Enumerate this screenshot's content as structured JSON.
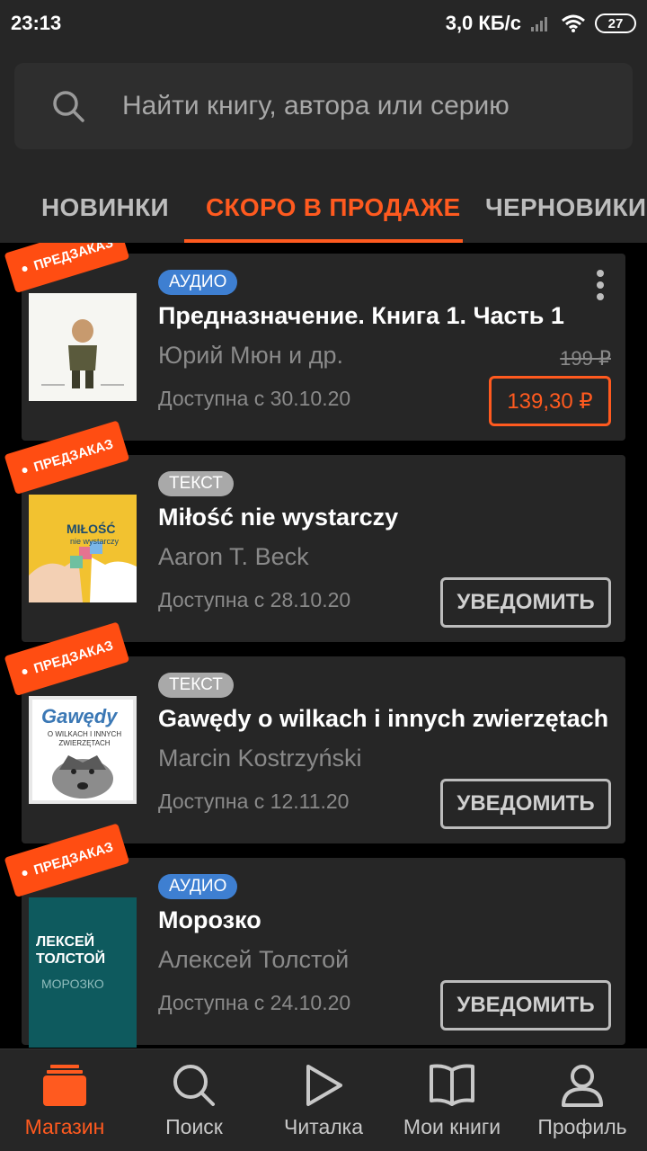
{
  "status_bar": {
    "time": "23:13",
    "speed": "3,0 КБ/с",
    "battery": "27"
  },
  "search": {
    "placeholder": "Найти книгу, автора или серию"
  },
  "tabs": [
    {
      "label": "НОВИНКИ",
      "active": false
    },
    {
      "label": "СКОРО В ПРОДАЖЕ",
      "active": true
    },
    {
      "label": "ЧЕРНОВИКИ",
      "active": false
    }
  ],
  "preorder_label": "ПРЕДЗАКАЗ",
  "books": [
    {
      "type": "АУДИО",
      "title": "Предназначение. Книга 1. Часть 1",
      "author": "Юрий Мюн и др.",
      "available": "Доступна с 30.10.20",
      "old_price": "199 ₽",
      "price": "139,30 ₽"
    },
    {
      "type": "ТЕКСТ",
      "title": "Miłość nie wystarczy",
      "author": "Aaron T. Beck",
      "available": "Доступна с 28.10.20",
      "action": "УВЕДОМИТЬ",
      "cover_text_1": "MIŁOŚĆ",
      "cover_text_2": "nie wystarczy"
    },
    {
      "type": "ТЕКСТ",
      "title": "Gawędy o wilkach i innych zwierzętach",
      "author": "Marcin Kostrzyński",
      "available": "Доступна с 12.11.20",
      "action": "УВЕДОМИТЬ",
      "cover_text_1": "Gawędy",
      "cover_text_2": "O WILKACH I INNYCH ZWIERZĘTACH"
    },
    {
      "type": "АУДИО",
      "title": "Морозко",
      "author": "Алексей Толстой",
      "available": "Доступна с 24.10.20",
      "action": "УВЕДОМИТЬ",
      "cover_text_1": "ЛЕКСЕЙ ТОЛСТОЙ",
      "cover_text_2": "МОРОЗКО"
    }
  ],
  "bottom_nav": [
    {
      "label": "Магазин",
      "icon": "store-icon",
      "active": true
    },
    {
      "label": "Поиск",
      "icon": "search-icon",
      "active": false
    },
    {
      "label": "Читалка",
      "icon": "play-icon",
      "active": false
    },
    {
      "label": "Мои книги",
      "icon": "book-icon",
      "active": false
    },
    {
      "label": "Профиль",
      "icon": "profile-icon",
      "active": false
    }
  ],
  "colors": {
    "accent": "#ff5a1f",
    "audio_badge": "#3e7fd1",
    "text_badge": "#a9a9a9",
    "background": "#000000",
    "surface": "#262626"
  }
}
